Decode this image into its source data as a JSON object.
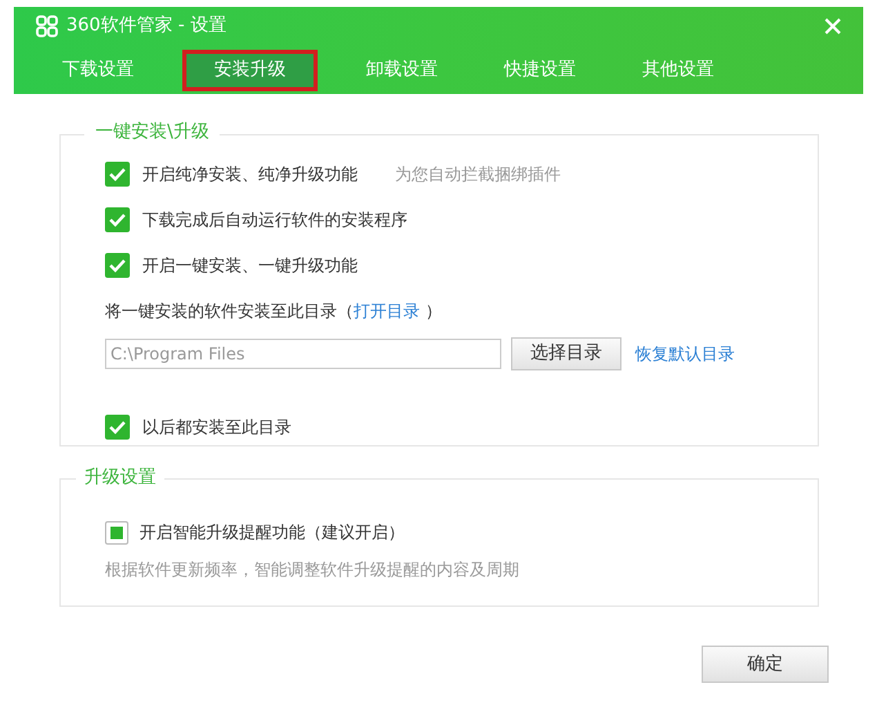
{
  "window": {
    "title": "360软件管家 - 设置"
  },
  "tabs": [
    {
      "label": "下载设置",
      "selected": false
    },
    {
      "label": "安装升级",
      "selected": true
    },
    {
      "label": "卸载设置",
      "selected": false
    },
    {
      "label": "快捷设置",
      "selected": false
    },
    {
      "label": "其他设置",
      "selected": false
    }
  ],
  "install_section": {
    "title": "一键安装\\升级",
    "options": [
      {
        "label": "开启纯净安装、纯净升级功能",
        "hint": "为您自动拦截捆绑插件",
        "checked": true
      },
      {
        "label": "下载完成后自动运行软件的安装程序",
        "checked": true
      },
      {
        "label": "开启一键安装、一键升级功能",
        "checked": true
      }
    ],
    "directory_label": "将一键安装的软件安装至此目录（",
    "open_link": "打开目录",
    "directory_label_end": "）",
    "directory_field": {
      "value": "C:\\Program Files"
    },
    "choose_button": "选择目录",
    "restore_link": "恢复默认目录",
    "remember": {
      "label": "以后都安装至此目录",
      "checked": true
    }
  },
  "upgrade_section": {
    "title": "升级设置",
    "option": {
      "label": "开启智能升级提醒功能（建议开启）",
      "checked": true,
      "kind": "square"
    },
    "description": "根据软件更新频率，智能调整软件升级提醒的内容及周期"
  },
  "ok_button": "确定"
}
